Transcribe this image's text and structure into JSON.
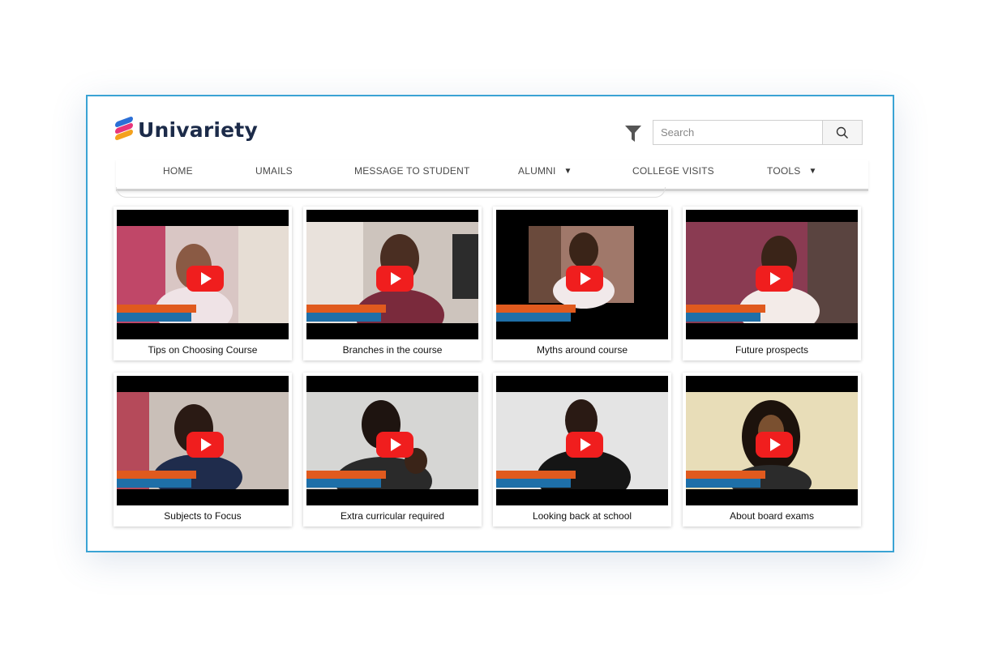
{
  "brand": {
    "name": "Univariety"
  },
  "header": {
    "filter_icon": "filter-icon",
    "search_placeholder": "Search",
    "search_icon": "search-icon"
  },
  "nav": [
    {
      "label": "HOME",
      "dropdown": false
    },
    {
      "label": "UMAILS",
      "dropdown": false
    },
    {
      "label": "MESSAGE TO STUDENT",
      "dropdown": false
    },
    {
      "label": "ALUMNI",
      "dropdown": true
    },
    {
      "label": "COLLEGE VISITS",
      "dropdown": false
    },
    {
      "label": "TOOLS",
      "dropdown": true
    }
  ],
  "videos": [
    {
      "title": "Tips on Choosing Course"
    },
    {
      "title": "Branches in the course"
    },
    {
      "title": "Myths around course"
    },
    {
      "title": "Future prospects"
    },
    {
      "title": "Subjects to Focus"
    },
    {
      "title": "Extra curricular required"
    },
    {
      "title": "Looking back at school"
    },
    {
      "title": "About board exams"
    }
  ],
  "colors": {
    "frame_border": "#3aa3d4",
    "brand_text": "#1c2b49",
    "play_button": "#f01e1e"
  }
}
